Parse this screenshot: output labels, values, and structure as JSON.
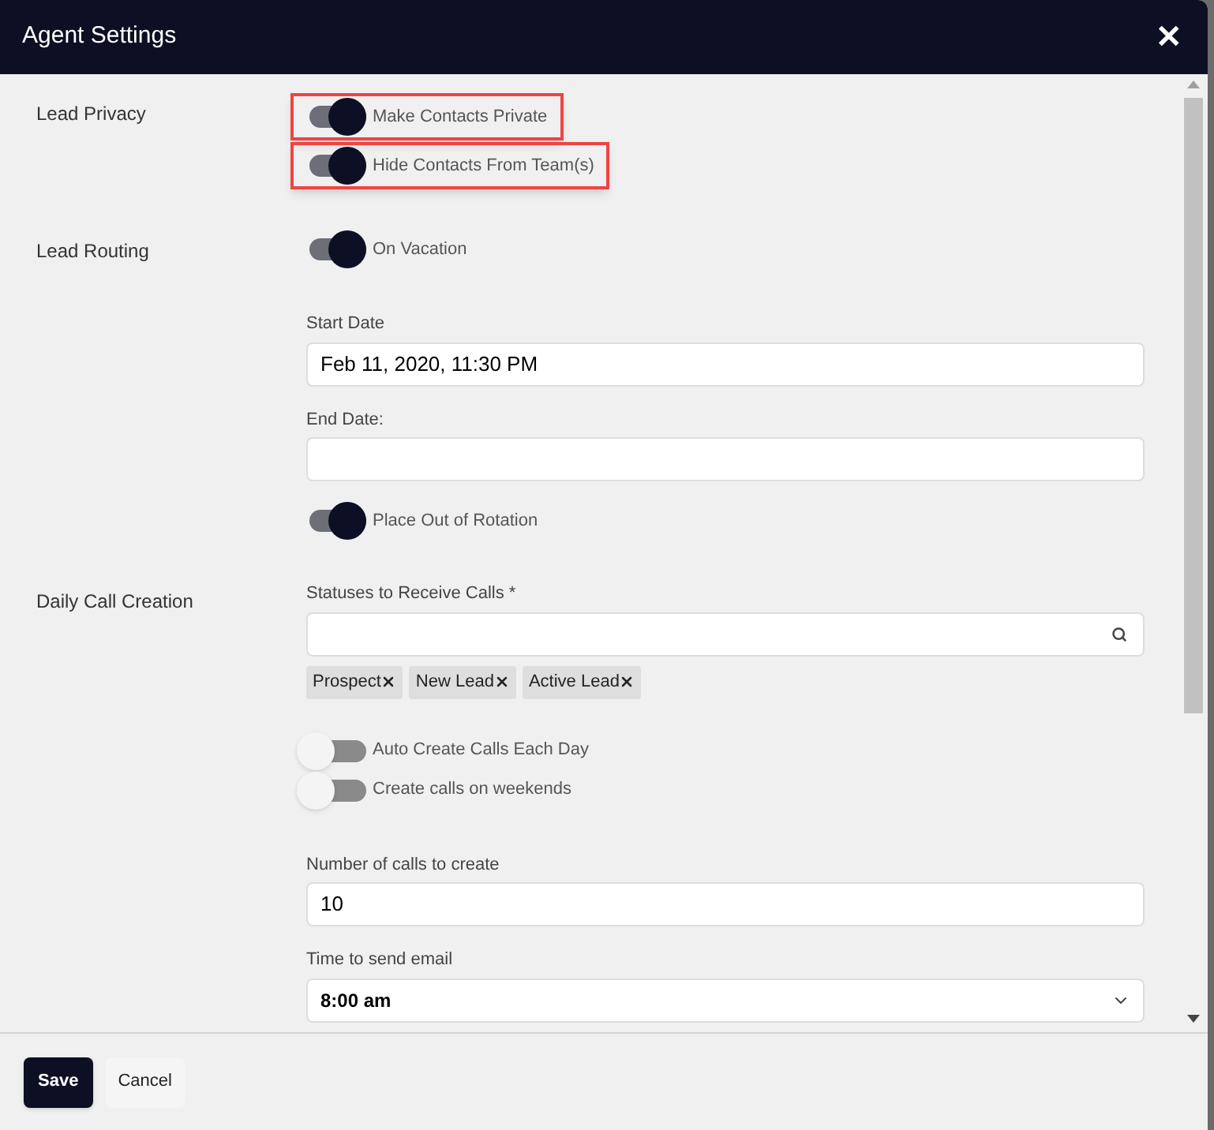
{
  "window": {
    "title": "Agent Settings",
    "close": "✕"
  },
  "sections": [
    {
      "label": "Lead Privacy",
      "items": [
        {
          "kind": "toggle",
          "label": "Make Contacts Private",
          "on": true,
          "highlighted": true
        },
        {
          "kind": "toggle",
          "label": "Hide Contacts From Team(s)",
          "on": true,
          "highlighted": true
        }
      ]
    },
    {
      "label": "Lead Routing",
      "items": [
        {
          "kind": "toggle",
          "label": "On Vacation",
          "on": true,
          "highlighted": false
        },
        {
          "kind": "field",
          "label": "Start Date",
          "value": "Feb 11, 2020, 11:30 PM"
        },
        {
          "kind": "field",
          "label": "End Date:",
          "value": ""
        },
        {
          "kind": "toggle",
          "label": "Place Out of Rotation",
          "on": true,
          "highlighted": false
        }
      ]
    },
    {
      "label": "Daily Call Creation",
      "items": [
        {
          "kind": "search",
          "label": "Statuses to Receive Calls *",
          "tags": [
            "Prospect",
            "New Lead",
            "Active Lead"
          ]
        },
        {
          "kind": "toggle",
          "label": "Auto Create Calls Each Day",
          "on": false,
          "highlighted": false
        },
        {
          "kind": "toggle",
          "label": "Create calls on weekends",
          "on": false,
          "highlighted": false
        },
        {
          "kind": "field",
          "label": "Number of calls to create",
          "value": "10"
        },
        {
          "kind": "select",
          "label": "Time to send email",
          "value": "8:00 am"
        }
      ]
    }
  ],
  "buttons": [
    {
      "label": "Save",
      "kind": "primary"
    },
    {
      "label": "Cancel",
      "kind": "secondary"
    }
  ]
}
